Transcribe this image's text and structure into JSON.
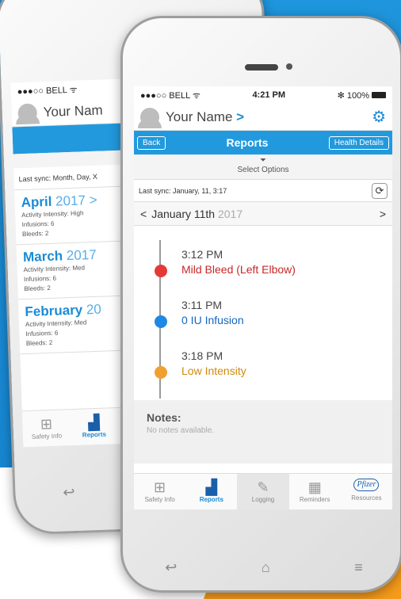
{
  "back_phone": {
    "status": {
      "carrier": "●●●○○ BELL ᯤ"
    },
    "user": {
      "name": "Your Nam"
    },
    "sync": "Last sync: Month, Day, X",
    "months": [
      {
        "month": "April",
        "year": "2017 >",
        "intensity": "Activity Intensity: High",
        "infusions": "Infusions: 6",
        "bleeds": "Bleeds: 2"
      },
      {
        "month": "March",
        "year": "2017",
        "intensity": "Activity Intensity: Med",
        "infusions": "Infusions: 6",
        "bleeds": "Bleeds: 2"
      },
      {
        "month": "February",
        "year": "20",
        "intensity": "Activity Intensity: Med",
        "infusions": "Infusions: 6",
        "bleeds": "Bleeds: 2"
      }
    ],
    "tabs": [
      "Safety Info",
      "Reports"
    ]
  },
  "front_phone": {
    "status": {
      "carrier": "●●●○○ BELL ᯤ",
      "time": "4:21 PM",
      "battery": "✻ 100%"
    },
    "user": {
      "name": "Your Name",
      "chevron": ">"
    },
    "nav": {
      "back": "Back",
      "title": "Reports",
      "health": "Health Details"
    },
    "select_options": "Select Options",
    "sync": "Last sync: January, 11, 3:17",
    "date": {
      "prev": "<",
      "day": "January 11th",
      "year": "2017",
      "next": ">"
    },
    "events": [
      {
        "time": "3:12 PM",
        "desc": "Mild Bleed (Left Elbow)",
        "color": "#e53935"
      },
      {
        "time": "3:11 PM",
        "desc": "0 IU Infusion",
        "color": "#1e88e5"
      },
      {
        "time": "3:18 PM",
        "desc": "Low Intensity",
        "color": "#f0a030"
      }
    ],
    "notes": {
      "title": "Notes:",
      "body": "No notes available."
    },
    "tabs": [
      "Safety Info",
      "Reports",
      "Logging",
      "Reminders",
      "Resources"
    ],
    "pfizer": "Pfizer"
  },
  "colors": {
    "brand_blue": "#1a8bd6",
    "accent_orange": "#f59a1b"
  }
}
